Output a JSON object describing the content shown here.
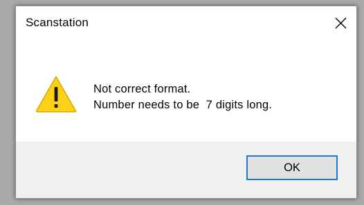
{
  "dialog": {
    "title": "Scanstation",
    "close_icon": "close-icon",
    "warning_icon": "warning-icon",
    "message_lines": [
      "Not correct format.",
      "Number needs to be  7 digits long."
    ],
    "ok_label": "OK"
  },
  "colors": {
    "accent": "#1e78d6",
    "footer_bg": "#f0f0f0",
    "warning_fill": "#fcd116"
  }
}
